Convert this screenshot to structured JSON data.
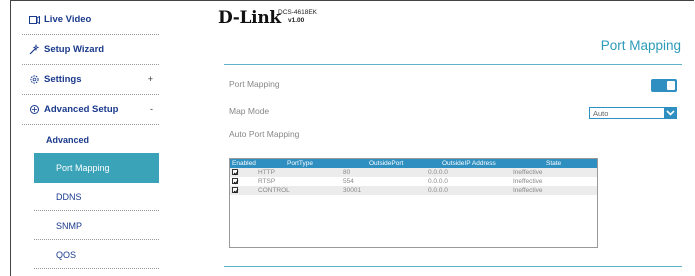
{
  "header": {
    "logo_text": "D-Link",
    "model": "DCS-4618EK",
    "version": "v1.00",
    "page_title": "Port Mapping"
  },
  "sidebar": {
    "items": [
      {
        "label": "Live Video",
        "icon": "video-icon"
      },
      {
        "label": "Setup Wizard",
        "icon": "wand-icon"
      },
      {
        "label": "Settings",
        "icon": "gear-icon",
        "sign": "+"
      },
      {
        "label": "Advanced Setup",
        "icon": "gear-advanced-icon",
        "sign": "-"
      }
    ],
    "sub_items": [
      {
        "label": "Advanced"
      },
      {
        "label": "Port Mapping"
      },
      {
        "label": "DDNS"
      },
      {
        "label": "SNMP"
      },
      {
        "label": "QOS"
      }
    ]
  },
  "form": {
    "port_mapping_label": "Port Mapping",
    "port_mapping_enabled": true,
    "map_mode_label": "Map Mode",
    "map_mode_value": "Auto",
    "auto_port_mapping_label": "Auto Port Mapping"
  },
  "table": {
    "headers": [
      "Enabled",
      "PortType",
      "OutsidePort",
      "OutsideIP Address",
      "State"
    ],
    "rows": [
      {
        "enabled": true,
        "port_type": "HTTP",
        "outside_port": "80",
        "outside_ip": "0.0.0.0",
        "state": "Ineffective"
      },
      {
        "enabled": true,
        "port_type": "RTSP",
        "outside_port": "554",
        "outside_ip": "0.0.0.0",
        "state": "Ineffective"
      },
      {
        "enabled": true,
        "port_type": "CONTROL",
        "outside_port": "30001",
        "outside_ip": "0.0.0.0",
        "state": "Ineffective"
      }
    ]
  },
  "colors": {
    "accent": "#2e8fc0",
    "active_nav": "#3aa3b8",
    "title": "#2e9bb8",
    "nav_text": "#1a3a8c"
  }
}
